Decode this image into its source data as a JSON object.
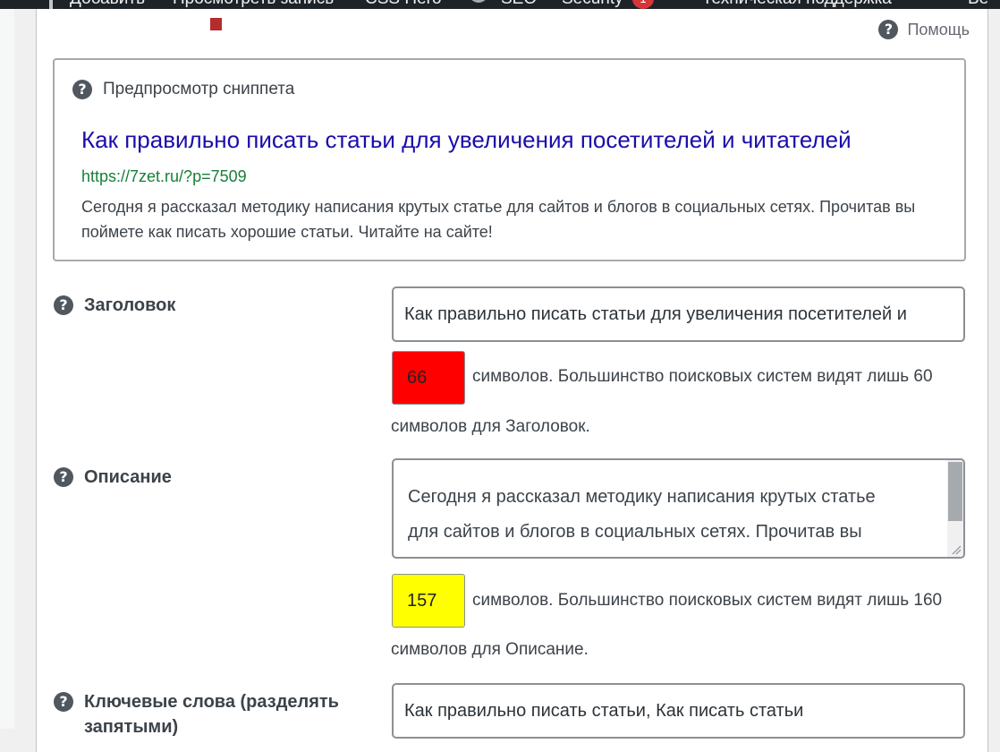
{
  "adminbar": {
    "items": [
      {
        "label": "Добавить"
      },
      {
        "label": "Просмотреть запись"
      },
      {
        "label": "CSS Hero"
      },
      {
        "label": "SEO"
      },
      {
        "label": "Security"
      },
      {
        "label": "Техническая поддержка"
      },
      {
        "label": "Be"
      }
    ],
    "security_badge": "1"
  },
  "help": {
    "label": "Помощь"
  },
  "snippet": {
    "heading": "Предпросмотр сниппета",
    "title": "Как правильно писать статьи для увеличения посетителей и читателей",
    "url": "https://7zet.ru/?p=7509",
    "description": "Сегодня я рассказал методику написания крутых статье для сайтов и блогов в социальных сетях. Прочитав вы поймете как писать хорошие статьи. Читайте на сайте!"
  },
  "fields": {
    "title": {
      "label": "Заголовок",
      "value": "Как правильно писать статьи для увеличения посетителей и",
      "count": "66",
      "count_color": "#ff0000",
      "count_text": "символов. Большинство поисковых систем видят лишь 60",
      "count_text2": "символов для Заголовок."
    },
    "description": {
      "label": "Описание",
      "value_line1": "Сегодня я рассказал методику написания крутых статье",
      "value_line2": "для сайтов и блогов в социальных сетях. Прочитав вы",
      "count": "157",
      "count_color": "#ffff00",
      "count_text": "символов. Большинство поисковых систем видят лишь 160",
      "count_text2": "символов для Описание."
    },
    "keywords": {
      "label_line1": "Ключевые слова (разделять",
      "label_line2": "запятыми)",
      "value": "Как правильно писать статьи, Как писать статьи"
    }
  }
}
